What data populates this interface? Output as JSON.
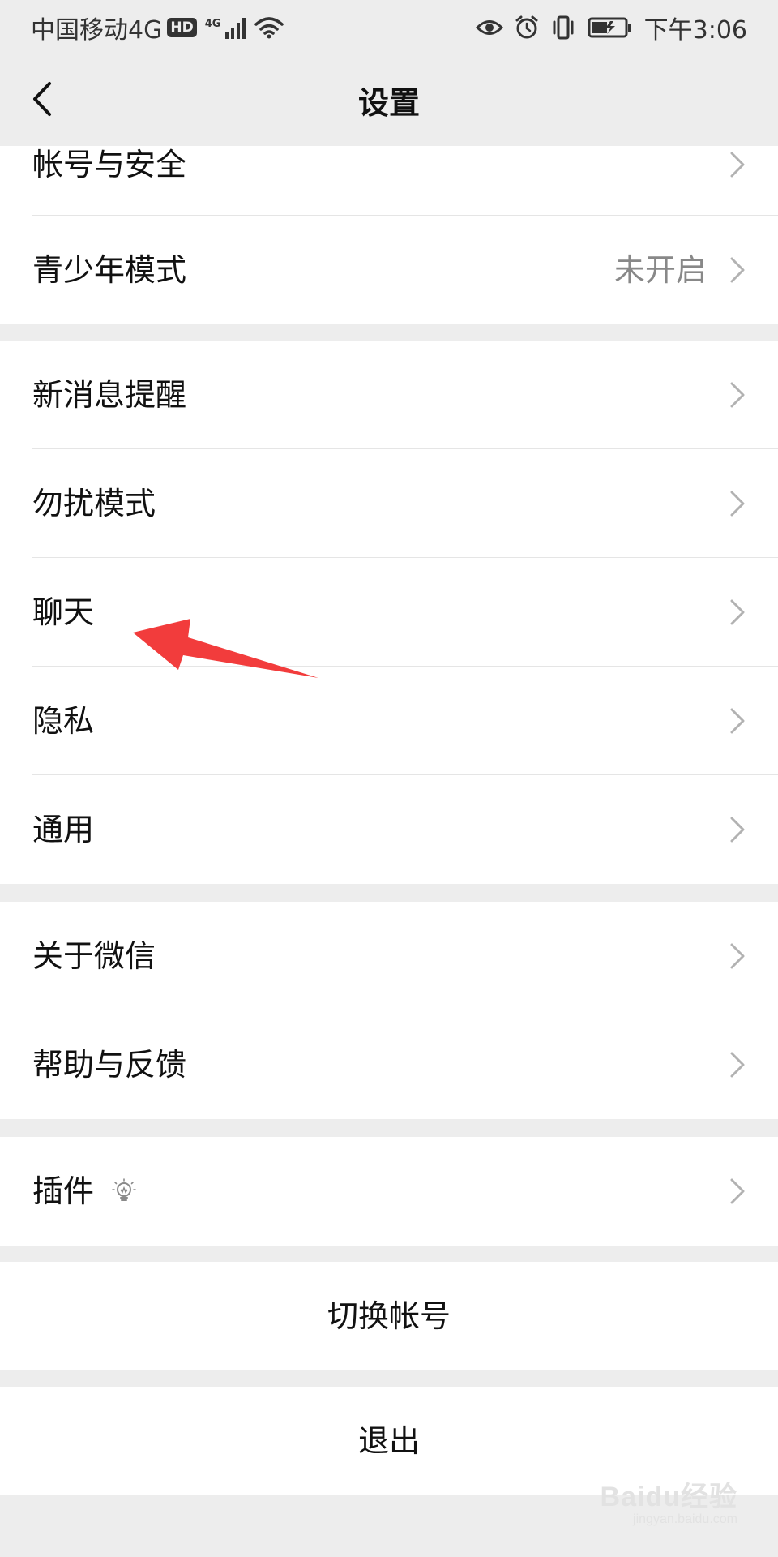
{
  "status_bar": {
    "carrier": "中国移动4G",
    "hd": "HD",
    "network_small": "4G",
    "time": "下午3:06",
    "icons": [
      "signal-icon",
      "wifi-icon",
      "eye-icon",
      "alarm-icon",
      "vibrate-icon",
      "battery-icon"
    ]
  },
  "nav": {
    "title": "设置",
    "back_icon": "chevron-left-icon"
  },
  "groups": [
    {
      "items": [
        {
          "label": "帐号与安全"
        },
        {
          "label": "青少年模式",
          "value": "未开启"
        }
      ]
    },
    {
      "items": [
        {
          "label": "新消息提醒"
        },
        {
          "label": "勿扰模式"
        },
        {
          "label": "聊天"
        },
        {
          "label": "隐私"
        },
        {
          "label": "通用"
        }
      ]
    },
    {
      "items": [
        {
          "label": "关于微信"
        },
        {
          "label": "帮助与反馈"
        }
      ]
    },
    {
      "items": [
        {
          "label": "插件",
          "icon": "lightbulb-icon"
        }
      ]
    }
  ],
  "actions": {
    "switch_account": "切换帐号",
    "logout": "退出"
  },
  "annotation": {
    "arrow_color": "#f23c3c",
    "arrow_points_to": "聊天"
  },
  "watermark": {
    "main": "Baidu经验",
    "sub": "jingyan.baidu.com"
  },
  "colors": {
    "background": "#ededed",
    "cell_background": "#ffffff",
    "divider": "#e5e5e5",
    "secondary_text": "#888888"
  }
}
